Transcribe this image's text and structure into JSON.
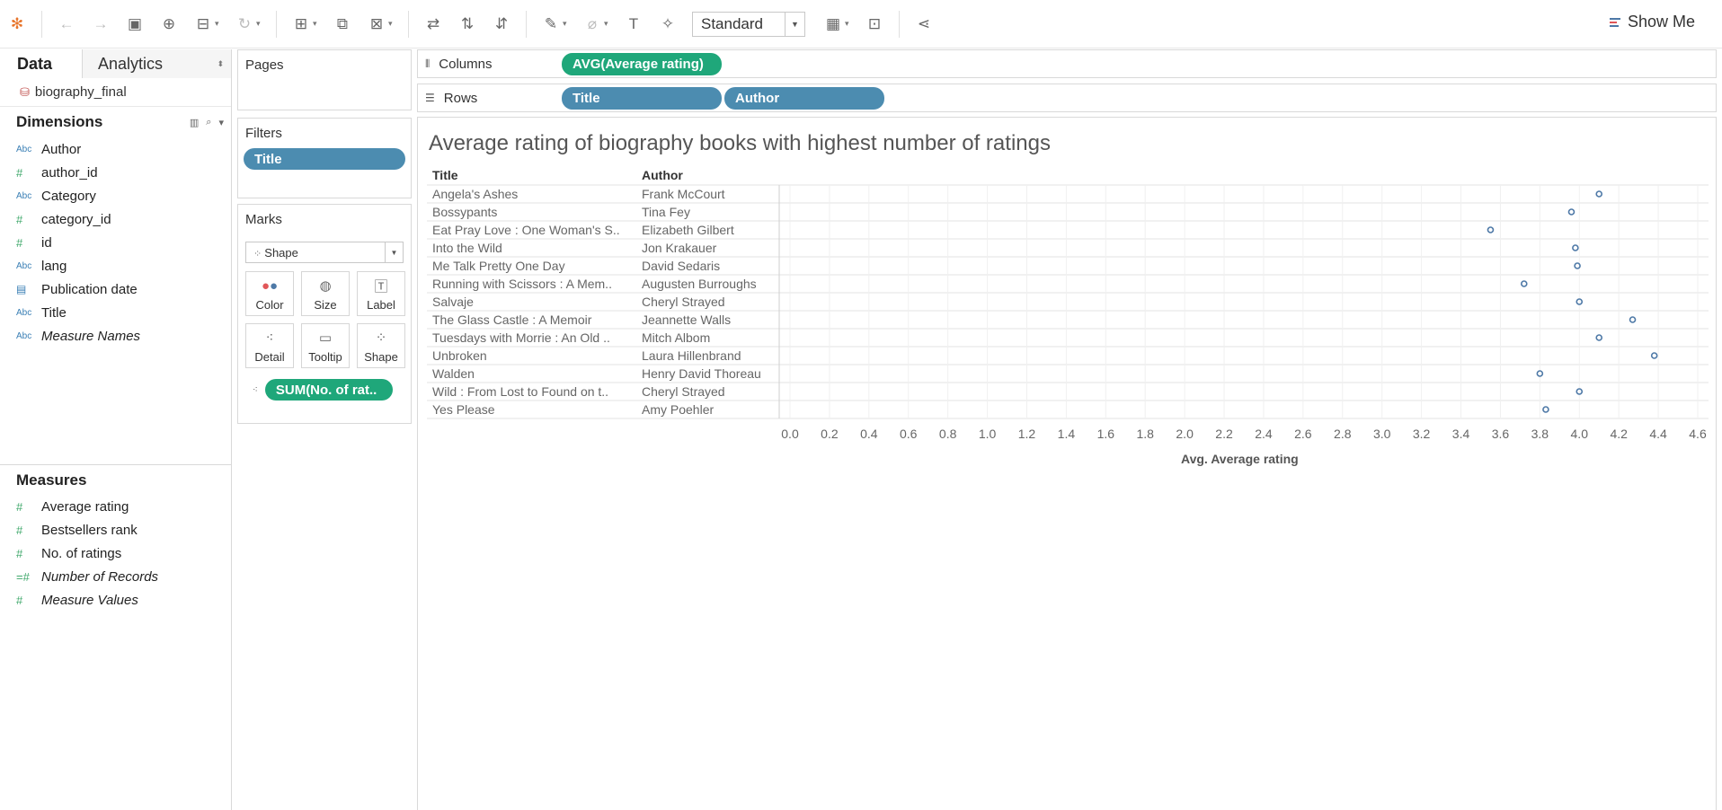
{
  "toolbar": {
    "fit_label": "Standard",
    "show_me_label": "Show Me",
    "icons": [
      "tableau-logo-icon",
      "undo-icon",
      "redo-icon",
      "save-icon",
      "new-datasource-icon",
      "pause-updates-icon",
      "refresh-icon",
      "new-worksheet-icon",
      "duplicate-icon",
      "clear-icon",
      "swap-icon",
      "sort-ascending-icon",
      "sort-descending-icon",
      "highlight-icon",
      "group-icon",
      "label-icon",
      "pin-icon",
      "fit-icon",
      "show-cards-icon",
      "presentation-icon",
      "share-icon"
    ]
  },
  "data_pane": {
    "tab_data": "Data",
    "tab_analytics": "Analytics",
    "datasource": "biography_final",
    "dimensions_title": "Dimensions",
    "dimensions": [
      {
        "label": "Author",
        "type": "Abc"
      },
      {
        "label": "author_id",
        "type": "#"
      },
      {
        "label": "Category",
        "type": "Abc"
      },
      {
        "label": "category_id",
        "type": "#"
      },
      {
        "label": "id",
        "type": "#"
      },
      {
        "label": "lang",
        "type": "Abc"
      },
      {
        "label": "Publication date",
        "type": "date"
      },
      {
        "label": "Title",
        "type": "Abc"
      },
      {
        "label": "Measure Names",
        "type": "Abc"
      }
    ],
    "measures_title": "Measures",
    "measures": [
      {
        "label": "Average rating",
        "type": "#"
      },
      {
        "label": "Bestsellers rank",
        "type": "#"
      },
      {
        "label": "No. of ratings",
        "type": "#"
      },
      {
        "label": "Number of Records",
        "type": "=#"
      },
      {
        "label": "Measure Values",
        "type": "#"
      }
    ]
  },
  "shelves": {
    "pages_label": "Pages",
    "filters_label": "Filters",
    "filter_pill": "Title",
    "marks_label": "Marks",
    "mark_type": "Shape",
    "mark_buttons": [
      "Color",
      "Size",
      "Label",
      "Detail",
      "Tooltip",
      "Shape"
    ],
    "marks_pill": "SUM(No. of rat..",
    "columns_label": "Columns",
    "columns_pill": "AVG(Average rating)",
    "rows_label": "Rows",
    "rows_pills": [
      "Title",
      "Author"
    ]
  },
  "colors": {
    "dimension_pill": "#4c8cb0",
    "measure_pill": "#1fa77a",
    "mark": "#4e79a7"
  },
  "chart_data": {
    "type": "scatter",
    "title": "Average rating of biography books with highest number of ratings",
    "header_title": "Title",
    "header_author": "Author",
    "rows": [
      {
        "title": "Angela's Ashes",
        "author": "Frank McCourt",
        "value": 4.1
      },
      {
        "title": "Bossypants",
        "author": "Tina Fey",
        "value": 3.96
      },
      {
        "title": "Eat Pray Love : One Woman's S..",
        "author": "Elizabeth Gilbert",
        "value": 3.55
      },
      {
        "title": "Into the Wild",
        "author": "Jon Krakauer",
        "value": 3.98
      },
      {
        "title": "Me Talk Pretty One Day",
        "author": "David Sedaris",
        "value": 3.99
      },
      {
        "title": "Running with Scissors : A Mem..",
        "author": "Augusten Burroughs",
        "value": 3.72
      },
      {
        "title": "Salvaje",
        "author": "Cheryl Strayed",
        "value": 4.0
      },
      {
        "title": "The Glass Castle : A Memoir",
        "author": "Jeannette Walls",
        "value": 4.27
      },
      {
        "title": "Tuesdays with Morrie : An Old ..",
        "author": "Mitch Albom",
        "value": 4.1
      },
      {
        "title": "Unbroken",
        "author": "Laura Hillenbrand",
        "value": 4.38
      },
      {
        "title": "Walden",
        "author": "Henry David Thoreau",
        "value": 3.8
      },
      {
        "title": "Wild : From Lost to Found on t..",
        "author": "Cheryl Strayed",
        "value": 4.0
      },
      {
        "title": "Yes Please",
        "author": "Amy Poehler",
        "value": 3.83
      }
    ],
    "xlabel": "Avg. Average rating",
    "xlim": [
      0,
      4.6
    ],
    "x_ticks": [
      "0.0",
      "0.2",
      "0.4",
      "0.6",
      "0.8",
      "1.0",
      "1.2",
      "1.4",
      "1.6",
      "1.8",
      "2.0",
      "2.2",
      "2.4",
      "2.6",
      "2.8",
      "3.0",
      "3.2",
      "3.4",
      "3.6",
      "3.8",
      "4.0",
      "4.2",
      "4.4",
      "4.6"
    ],
    "grid": true
  }
}
